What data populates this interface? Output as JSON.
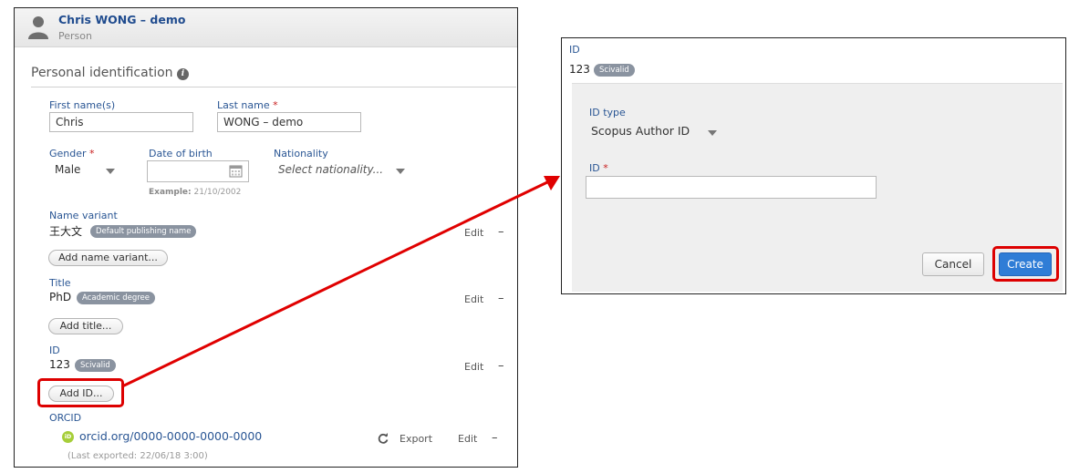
{
  "person": {
    "name": "Chris WONG – demo",
    "type": "Person"
  },
  "section": {
    "title": "Personal identification",
    "info_glyph": "i"
  },
  "fields": {
    "first_name": {
      "label": "First name(s)",
      "value": "Chris"
    },
    "last_name": {
      "label": "Last name",
      "value": "WONG – demo"
    },
    "gender": {
      "label": "Gender",
      "value": "Male"
    },
    "dob": {
      "label": "Date of birth",
      "value": "",
      "hint_prefix": "Example:",
      "hint_value": "21/10/2002"
    },
    "nationality": {
      "label": "Nationality",
      "placeholder": "Select nationality..."
    }
  },
  "required_mark": "*",
  "name_variant": {
    "label": "Name variant",
    "value": "王大文",
    "badge": "Default publishing name",
    "add_label": "Add name variant..."
  },
  "title_block": {
    "label": "Title",
    "value": "PhD",
    "badge": "Academic degree",
    "add_label": "Add title..."
  },
  "id_block": {
    "label": "ID",
    "value": "123",
    "badge": "Scivalid",
    "add_label": "Add ID..."
  },
  "orcid": {
    "label": "ORCID",
    "link_prefix": "orcid.org/",
    "link_id": "0000-0000-0000-0000",
    "export_label": "Export",
    "last_exported": "(Last exported: 22/06/18 3:00)",
    "logo_glyph": "iD"
  },
  "actions": {
    "edit": "Edit",
    "remove": "–"
  },
  "popup": {
    "id_label": "ID",
    "id_value": "123",
    "id_badge": "Scivalid",
    "type_label": "ID type",
    "type_value": "Scopus Author ID",
    "id_field_label": "ID",
    "id_field_value": "",
    "cancel_label": "Cancel",
    "create_label": "Create"
  },
  "colors": {
    "accent": "#2a5694",
    "required": "#c81c1c",
    "highlight": "#dd0000",
    "primary_button": "#2f7dd6",
    "orcid": "#a6ce39"
  }
}
